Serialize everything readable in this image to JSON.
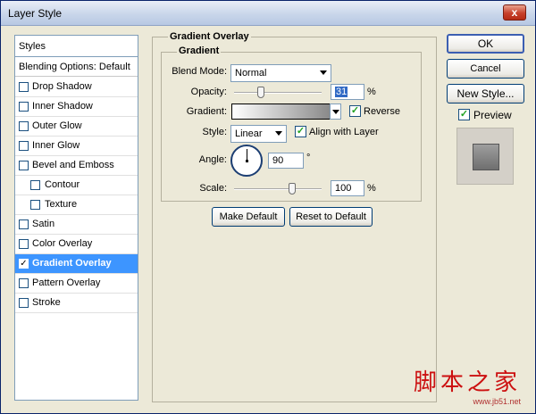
{
  "window": {
    "title": "Layer Style",
    "close_label": "x"
  },
  "styles": {
    "header": "Styles",
    "blending_options": "Blending Options: Default",
    "items": [
      {
        "label": "Drop Shadow",
        "checked": false
      },
      {
        "label": "Inner Shadow",
        "checked": false
      },
      {
        "label": "Outer Glow",
        "checked": false
      },
      {
        "label": "Inner Glow",
        "checked": false
      },
      {
        "label": "Bevel and Emboss",
        "checked": false
      },
      {
        "label": "Contour",
        "checked": false
      },
      {
        "label": "Texture",
        "checked": false
      },
      {
        "label": "Satin",
        "checked": false
      },
      {
        "label": "Color Overlay",
        "checked": false
      },
      {
        "label": "Gradient Overlay",
        "checked": true,
        "selected": true
      },
      {
        "label": "Pattern Overlay",
        "checked": false
      },
      {
        "label": "Stroke",
        "checked": false
      }
    ],
    "check_mark": "✓"
  },
  "gradient_overlay": {
    "section_title": "Gradient Overlay",
    "group_title": "Gradient",
    "blend_mode_label": "Blend Mode:",
    "blend_mode_value": "Normal",
    "opacity_label": "Opacity:",
    "opacity_value": "31",
    "opacity_fraction": 0.31,
    "percent": "%",
    "gradient_label": "Gradient:",
    "reverse_label": "Reverse",
    "reverse_checked": true,
    "style_label": "Style:",
    "style_value": "Linear",
    "align_label": "Align with Layer",
    "align_checked": true,
    "angle_label": "Angle:",
    "angle_value": "90",
    "degree": "°",
    "scale_label": "Scale:",
    "scale_value": "100",
    "scale_fraction": 0.66,
    "make_default": "Make Default",
    "reset_default": "Reset to Default",
    "gradient_colors": [
      "#ffffff",
      "#8a8a8a"
    ]
  },
  "actions": {
    "ok": "OK",
    "cancel": "Cancel",
    "new_style": "New Style...",
    "preview_label": "Preview",
    "preview_checked": true
  },
  "watermark": {
    "big": "脚本之家",
    "small": "www.jb51.net"
  },
  "colors": {
    "selection": "#3d95ff",
    "dialog": "#ece9d8"
  }
}
